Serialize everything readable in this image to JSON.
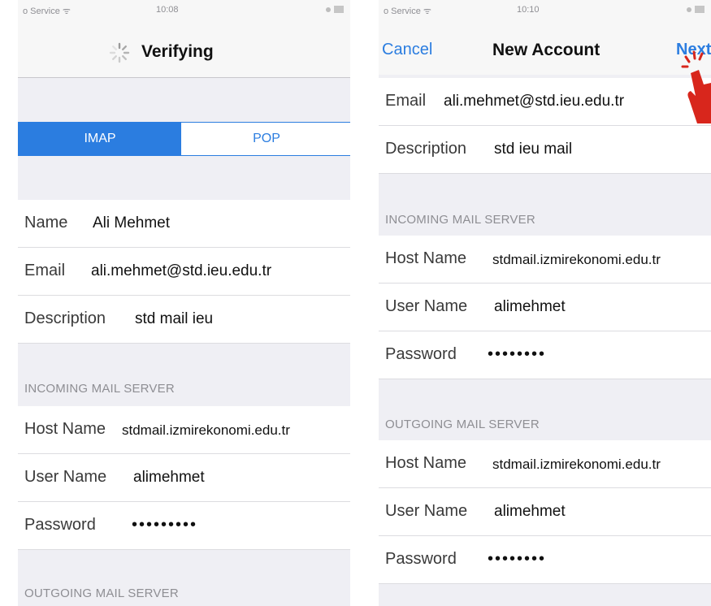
{
  "left": {
    "status": {
      "carrier": "o Service ᯤ",
      "time": "10:08"
    },
    "nav": {
      "title": "Verifying"
    },
    "segments": {
      "imap": "IMAP",
      "pop": "POP"
    },
    "fields": {
      "name_label": "Name",
      "name_value": "Ali Mehmet",
      "email_label": "Email",
      "email_value": "ali.mehmet@std.ieu.edu.tr",
      "desc_label": "Description",
      "desc_value": "std mail ieu"
    },
    "incoming": {
      "header": "INCOMING MAIL SERVER",
      "host_label": "Host Name",
      "host_value": "stdmail.izmirekonomi.edu.tr",
      "user_label": "User Name",
      "user_value": "alimehmet",
      "pass_label": "Password",
      "pass_value": "•••••••••"
    },
    "outgoing": {
      "header": "OUTGOING MAIL SERVER"
    }
  },
  "right": {
    "status": {
      "carrier": "o Service ᯤ",
      "time": "10:10"
    },
    "nav": {
      "cancel": "Cancel",
      "title": "New Account",
      "next": "Next"
    },
    "fields": {
      "email_label": "Email",
      "email_value": "ali.mehmet@std.ieu.edu.tr",
      "desc_label": "Description",
      "desc_value": "std ieu mail"
    },
    "incoming": {
      "header": "INCOMING MAIL SERVER",
      "host_label": "Host Name",
      "host_value": "stdmail.izmirekonomi.edu.tr",
      "user_label": "User Name",
      "user_value": "alimehmet",
      "pass_label": "Password",
      "pass_value": "••••••••"
    },
    "outgoing": {
      "header": "OUTGOING MAIL SERVER",
      "host_label": "Host Name",
      "host_value": "stdmail.izmirekonomi.edu.tr",
      "user_label": "User Name",
      "user_value": "alimehmet",
      "pass_label": "Password",
      "pass_value": "••••••••"
    }
  },
  "colors": {
    "accent": "#2b7de0",
    "pointer": "#d8261c",
    "background": "#efeff4"
  },
  "icons": [
    "activity-spinner-icon",
    "tap-pointer-hand-icon",
    "wifi-icon",
    "battery-icon"
  ]
}
